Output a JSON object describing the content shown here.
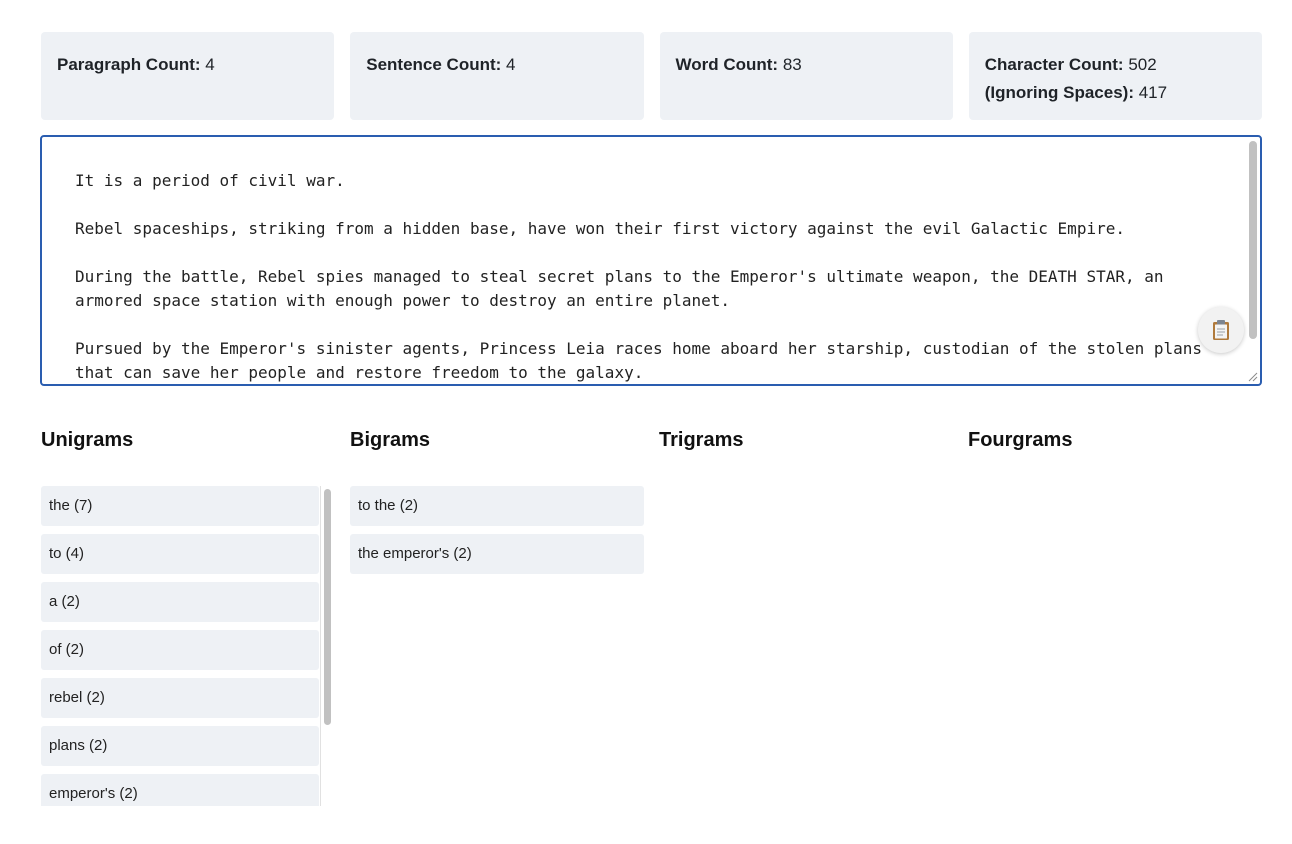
{
  "stats": {
    "paragraph": {
      "label": "Paragraph Count:",
      "value": "4"
    },
    "sentence": {
      "label": "Sentence Count:",
      "value": "4"
    },
    "word": {
      "label": "Word Count:",
      "value": "83"
    },
    "character": {
      "label": "Character Count:",
      "value": "502"
    },
    "ignoring_spaces": {
      "label": "(Ignoring Spaces):",
      "value": "417"
    }
  },
  "editor": {
    "text": "It is a period of civil war.\n\nRebel spaceships, striking from a hidden base, have won their first victory against the evil Galactic Empire.\n\nDuring the battle, Rebel spies managed to steal secret plans to the Emperor's ultimate weapon, the DEATH STAR, an armored space station with enough power to destroy an entire planet.\n\nPursued by the Emperor's sinister agents, Princess Leia races home aboard her starship, custodian of the stolen plans that can save her people and restore freedom to the galaxy.",
    "copy_icon": "clipboard-icon"
  },
  "ngrams": {
    "unigrams": {
      "title": "Unigrams",
      "items": [
        "the (7)",
        "to (4)",
        "a (2)",
        "of (2)",
        "rebel (2)",
        "plans (2)",
        "emperor's (2)"
      ]
    },
    "bigrams": {
      "title": "Bigrams",
      "items": [
        "to the (2)",
        "the emperor's (2)"
      ]
    },
    "trigrams": {
      "title": "Trigrams",
      "items": []
    },
    "fourgrams": {
      "title": "Fourgrams",
      "items": []
    }
  },
  "colors": {
    "card_background": "#eef1f5",
    "editor_border": "#2a5db0",
    "scroll_thumb": "#c1c1c1"
  }
}
